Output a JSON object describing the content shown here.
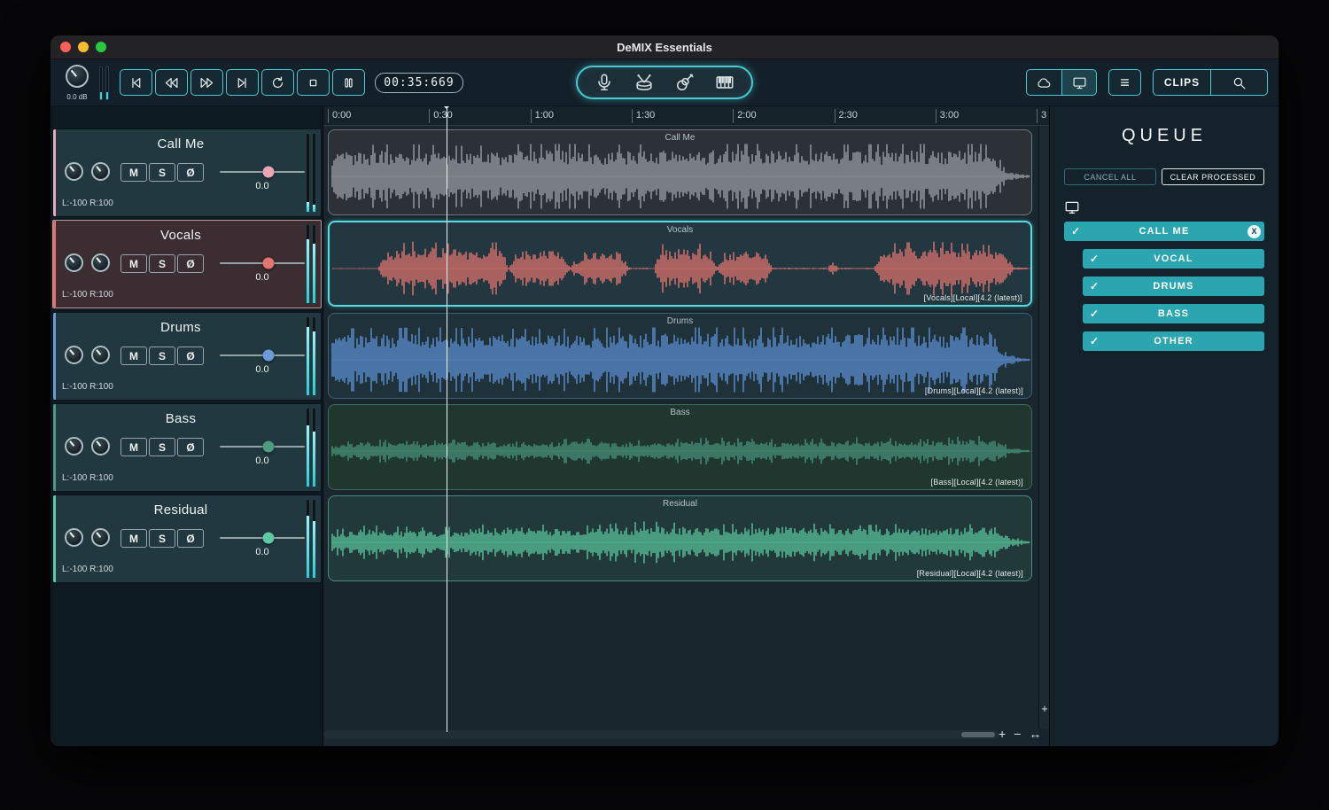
{
  "window": {
    "title": "DeMIX Essentials"
  },
  "toolbar": {
    "gain_label": "0.0 dB",
    "time_display": "00:35:669",
    "clips_label": "CLIPS",
    "icons": {
      "transport": [
        "skip-start",
        "rewind",
        "fast-forward",
        "skip-end",
        "loop",
        "stop",
        "pause"
      ],
      "stems": [
        "microphone",
        "drums",
        "guitar",
        "piano"
      ],
      "right": [
        "cloud",
        "monitor",
        "menu",
        "clips",
        "search"
      ]
    }
  },
  "ruler": {
    "ticks": [
      "0:00",
      "0:30",
      "1:00",
      "1:30",
      "2:00",
      "2:30",
      "3:00",
      "3"
    ]
  },
  "track_controls": {
    "mute": "M",
    "solo": "S",
    "phase": "Ø"
  },
  "tracks": [
    {
      "name": "Call Me",
      "volume": "0.0",
      "pan": "L:-100 R:100",
      "tag": "",
      "color": "#e9a6b5",
      "wave_color": "#9aa0a4",
      "clip_bg": "#2b3137",
      "clip_border": "#6f777c",
      "selected": false,
      "meter": [
        0.12,
        0.09
      ],
      "envelope": [
        [
          0,
          0.35
        ],
        [
          0.01,
          0.75
        ],
        [
          0.1,
          0.8
        ],
        [
          0.2,
          0.75
        ],
        [
          0.3,
          0.82
        ],
        [
          0.4,
          0.78
        ],
        [
          0.5,
          0.8
        ],
        [
          0.6,
          0.83
        ],
        [
          0.7,
          0.78
        ],
        [
          0.8,
          0.8
        ],
        [
          0.9,
          0.82
        ],
        [
          0.93,
          0.9
        ],
        [
          0.955,
          0.45
        ],
        [
          0.97,
          0.12
        ],
        [
          1,
          0.04
        ]
      ]
    },
    {
      "name": "Vocals",
      "volume": "0.0",
      "pan": "L:-100 R:100",
      "tag": "[Vocals][Local][4.2 (latest)]",
      "color": "#e4756e",
      "wave_color": "#e4756e",
      "clip_bg": "#223740",
      "clip_border": "#55dbe2",
      "selected": true,
      "meter": [
        0.82,
        0.76
      ],
      "envelope": [
        [
          0,
          0.01
        ],
        [
          0.065,
          0.01
        ],
        [
          0.075,
          0.55
        ],
        [
          0.12,
          0.68
        ],
        [
          0.18,
          0.6
        ],
        [
          0.24,
          0.65
        ],
        [
          0.252,
          0.03
        ],
        [
          0.265,
          0.55
        ],
        [
          0.33,
          0.6
        ],
        [
          0.34,
          0.03
        ],
        [
          0.36,
          0.5
        ],
        [
          0.41,
          0.58
        ],
        [
          0.425,
          0.02
        ],
        [
          0.46,
          0.02
        ],
        [
          0.47,
          0.6
        ],
        [
          0.54,
          0.62
        ],
        [
          0.55,
          0.03
        ],
        [
          0.565,
          0.5
        ],
        [
          0.62,
          0.55
        ],
        [
          0.63,
          0.02
        ],
        [
          0.71,
          0.02
        ],
        [
          0.715,
          0.28
        ],
        [
          0.725,
          0.02
        ],
        [
          0.775,
          0.02
        ],
        [
          0.785,
          0.6
        ],
        [
          0.85,
          0.68
        ],
        [
          0.92,
          0.6
        ],
        [
          0.96,
          0.55
        ],
        [
          0.975,
          0.05
        ],
        [
          1,
          0.01
        ]
      ]
    },
    {
      "name": "Drums",
      "volume": "0.0",
      "pan": "L:-100 R:100",
      "tag": "[Drums][Local][4.2 (latest)]",
      "color": "#6b9cd9",
      "wave_color": "#5d92d6",
      "clip_bg": "#1f3139",
      "clip_border": "#3f5d7e",
      "selected": false,
      "meter": [
        0.88,
        0.82
      ],
      "envelope": [
        [
          0,
          0.6
        ],
        [
          0.02,
          0.78
        ],
        [
          0.15,
          0.8
        ],
        [
          0.3,
          0.76
        ],
        [
          0.45,
          0.82
        ],
        [
          0.6,
          0.8
        ],
        [
          0.75,
          0.82
        ],
        [
          0.88,
          0.8
        ],
        [
          0.93,
          0.92
        ],
        [
          0.96,
          0.3
        ],
        [
          0.98,
          0.08
        ],
        [
          1,
          0.03
        ]
      ]
    },
    {
      "name": "Bass",
      "volume": "0.0",
      "pan": "L:-100 R:100",
      "tag": "[Bass][Local][4.2 (latest)]",
      "color": "#4d9b7e",
      "wave_color": "#47937a",
      "clip_bg": "#203730",
      "clip_border": "#3a6b59",
      "selected": false,
      "meter": [
        0.78,
        0.7
      ],
      "envelope": [
        [
          0,
          0.18
        ],
        [
          0.05,
          0.3
        ],
        [
          0.12,
          0.24
        ],
        [
          0.2,
          0.3
        ],
        [
          0.28,
          0.22
        ],
        [
          0.35,
          0.32
        ],
        [
          0.45,
          0.26
        ],
        [
          0.55,
          0.34
        ],
        [
          0.65,
          0.28
        ],
        [
          0.75,
          0.34
        ],
        [
          0.85,
          0.3
        ],
        [
          0.92,
          0.38
        ],
        [
          0.95,
          0.34
        ],
        [
          0.97,
          0.1
        ],
        [
          1,
          0.03
        ]
      ]
    },
    {
      "name": "Residual",
      "volume": "0.0",
      "pan": "L:-100 R:100",
      "tag": "[Residual][Local][4.2 (latest)]",
      "color": "#5fc9a4",
      "wave_color": "#5cc6a0",
      "clip_bg": "#213a39",
      "clip_border": "#478f7a",
      "selected": false,
      "meter": [
        0.8,
        0.73
      ],
      "envelope": [
        [
          0,
          0.3
        ],
        [
          0.05,
          0.42
        ],
        [
          0.15,
          0.36
        ],
        [
          0.25,
          0.48
        ],
        [
          0.35,
          0.4
        ],
        [
          0.45,
          0.52
        ],
        [
          0.55,
          0.44
        ],
        [
          0.65,
          0.5
        ],
        [
          0.75,
          0.42
        ],
        [
          0.85,
          0.48
        ],
        [
          0.92,
          0.44
        ],
        [
          0.95,
          0.5
        ],
        [
          0.97,
          0.14
        ],
        [
          1,
          0.04
        ]
      ]
    }
  ],
  "queue": {
    "title": "QUEUE",
    "cancel_all_label": "CANCEL ALL",
    "clear_processed_label": "CLEAR PROCESSED",
    "job": {
      "name": "CALL ME",
      "close_label": "X",
      "stems": [
        "VOCAL",
        "DRUMS",
        "BASS",
        "OTHER"
      ]
    }
  },
  "zoom": {
    "h_plus": "+",
    "h_minus": "−",
    "h_fit": "↔",
    "v_plus": "+"
  },
  "icons": {
    "check": "✓",
    "menu": "≡"
  },
  "colors": {
    "accent": "#49c9d4",
    "queue_item": "#2ba6b0",
    "playhead": "#eff4f5"
  }
}
